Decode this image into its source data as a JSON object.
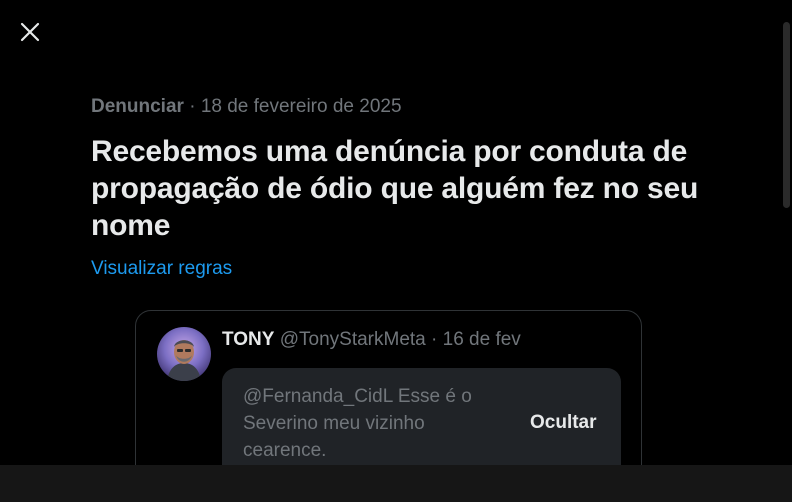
{
  "report": {
    "label": "Denunciar",
    "separator": "·",
    "date": "18 de fevereiro de 2025",
    "headline": "Recebemos uma denúncia por conduta de propagação de ódio que alguém fez no seu nome",
    "rules_link": "Visualizar regras"
  },
  "tweet": {
    "display_name": "TONY",
    "handle": "@TonyStarkMeta",
    "separator": "·",
    "date": "16 de fev",
    "hidden_text": "@Fernanda_CidL Esse é o Severino meu vizinho cearence.",
    "hide_button": "Ocultar"
  },
  "icons": {
    "close": "close-icon",
    "avatar": "avatar"
  },
  "colors": {
    "background": "#000000",
    "text_primary": "#e7e9ea",
    "text_secondary": "#71767b",
    "link": "#1d9bf0",
    "card_border": "#2f3336",
    "hidden_box": "#202327"
  }
}
